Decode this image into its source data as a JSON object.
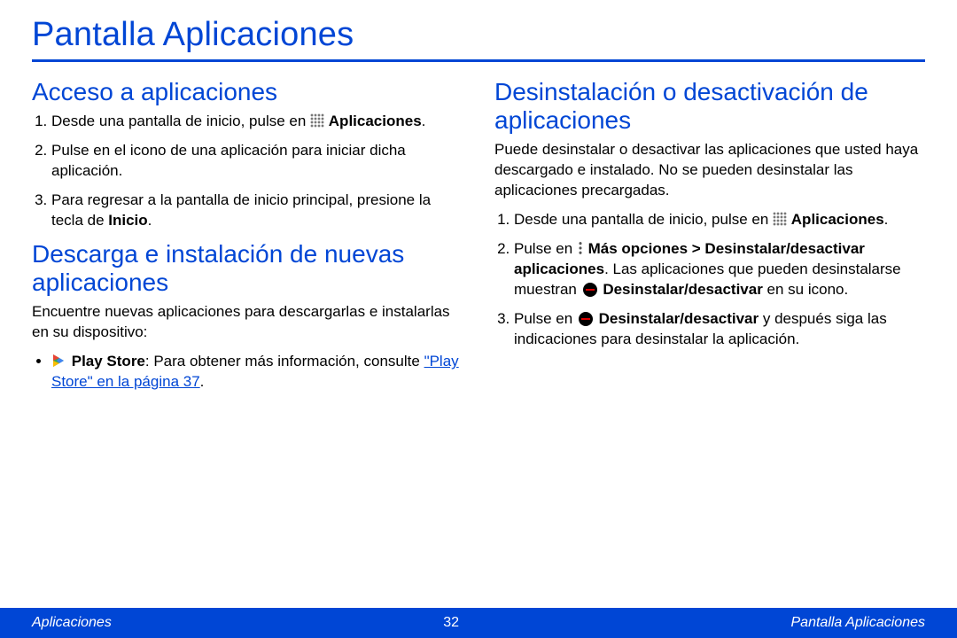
{
  "page_title": "Pantalla Aplicaciones",
  "left": {
    "section1": {
      "heading": "Acceso a aplicaciones",
      "items": [
        {
          "pre": "Desde una pantalla de inicio, pulse en ",
          "icon": "apps",
          "post": " ",
          "bold_after": "Aplicaciones",
          "tail": "."
        },
        {
          "text": "Pulse en el icono de una aplicación para iniciar dicha aplicación."
        },
        {
          "pre": "Para regresar a la pantalla de inicio principal, presione la tecla de ",
          "bold_after": "Inicio",
          "tail": "."
        }
      ]
    },
    "section2": {
      "heading": "Descarga e instalación de nuevas aplicaciones",
      "intro": "Encuentre nuevas aplicaciones para descargarlas e instalarlas en su dispositivo:",
      "bullet": {
        "bold": "Play Store",
        "rest": ": Para obtener más información, consulte ",
        "link": "\"Play Store\" en la página 37",
        "tail": "."
      }
    }
  },
  "right": {
    "section": {
      "heading": "Desinstalación o desactivación de aplicaciones",
      "intro": "Puede desinstalar o desactivar las aplicaciones que usted haya descargado e instalado. No se pueden desinstalar las aplicaciones precargadas.",
      "items": [
        {
          "pre": "Desde una pantalla de inicio, pulse en ",
          "icon": "apps",
          "post": " ",
          "bold_after": "Aplicaciones",
          "tail": "."
        },
        {
          "pre": "Pulse en ",
          "icon": "more",
          "bold1": " Más opciones > Desinstalar/desactivar aplicaciones",
          "mid": ". Las aplicaciones que pueden desinstalarse muestran ",
          "icon2": "uninstall",
          "bold2": " Desinstalar/desactivar",
          "tail": " en su icono."
        },
        {
          "pre": "Pulse en ",
          "icon": "uninstall",
          "bold1": " Desinstalar/desactivar",
          "tail": " y después siga las indicaciones para desinstalar la aplicación."
        }
      ]
    }
  },
  "footer": {
    "left": "Aplicaciones",
    "center": "32",
    "right": "Pantalla Aplicaciones"
  }
}
